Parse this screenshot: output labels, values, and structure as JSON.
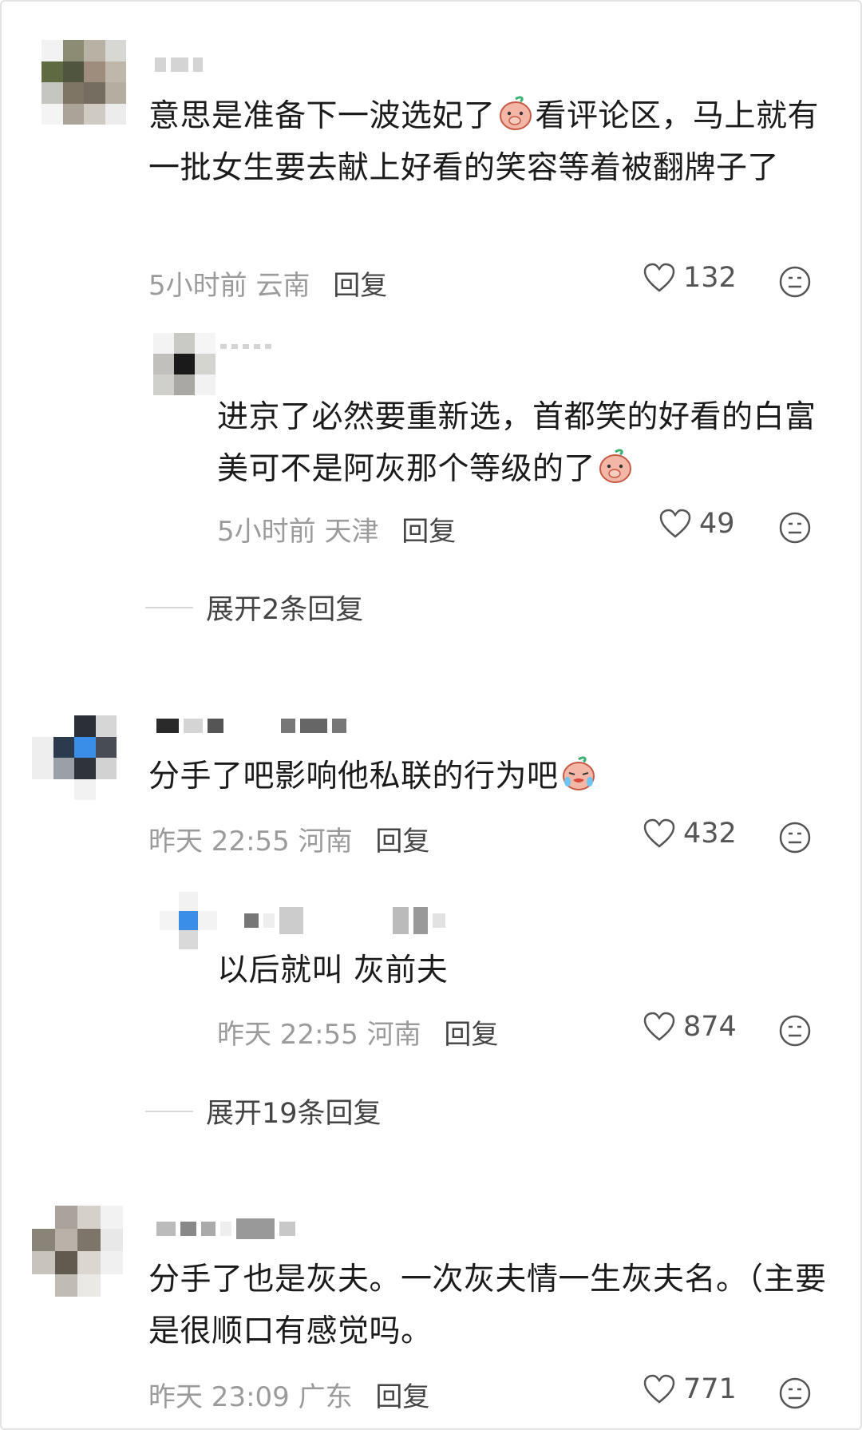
{
  "comments": [
    {
      "text": "意思是准备下一波选妃了",
      "text_after": "看评论区，马上就有一批女生要去献上好看的笑容等着被翻牌子了",
      "emoji": "peach-cover-mouth-emoji",
      "time": "5小时前",
      "location": "云南",
      "reply_label": "回复",
      "likes": "132",
      "reply": {
        "text": "进京了必然要重新选，首都笑的好看的白富美可不是阿灰那个等级的了",
        "emoji": "peach-cover-mouth-emoji",
        "time": "5小时前",
        "location": "天津",
        "reply_label": "回复",
        "likes": "49"
      },
      "expand_label": "展开2条回复"
    },
    {
      "text": "分手了吧影响他私联的行为吧",
      "emoji": "peach-crying-emoji",
      "time": "昨天 22:55",
      "location": "河南",
      "reply_label": "回复",
      "likes": "432",
      "reply": {
        "text": "以后就叫 灰前夫",
        "time": "昨天 22:55",
        "location": "河南",
        "reply_label": "回复",
        "likes": "874"
      },
      "expand_label": "展开19条回复"
    },
    {
      "text": "分手了也是灰夫。一次灰夫情一生灰夫名。（主要是很顺口有感觉吗。",
      "time": "昨天 23:09",
      "location": "广东",
      "reply_label": "回复",
      "likes": "771"
    }
  ],
  "colors": {
    "text": "#1b1b1b",
    "meta": "#9b9b9b",
    "reply_link": "#444444",
    "icon": "#555555"
  },
  "icons": {
    "like": "heart-outline-icon",
    "dislike": "meh-face-icon"
  }
}
